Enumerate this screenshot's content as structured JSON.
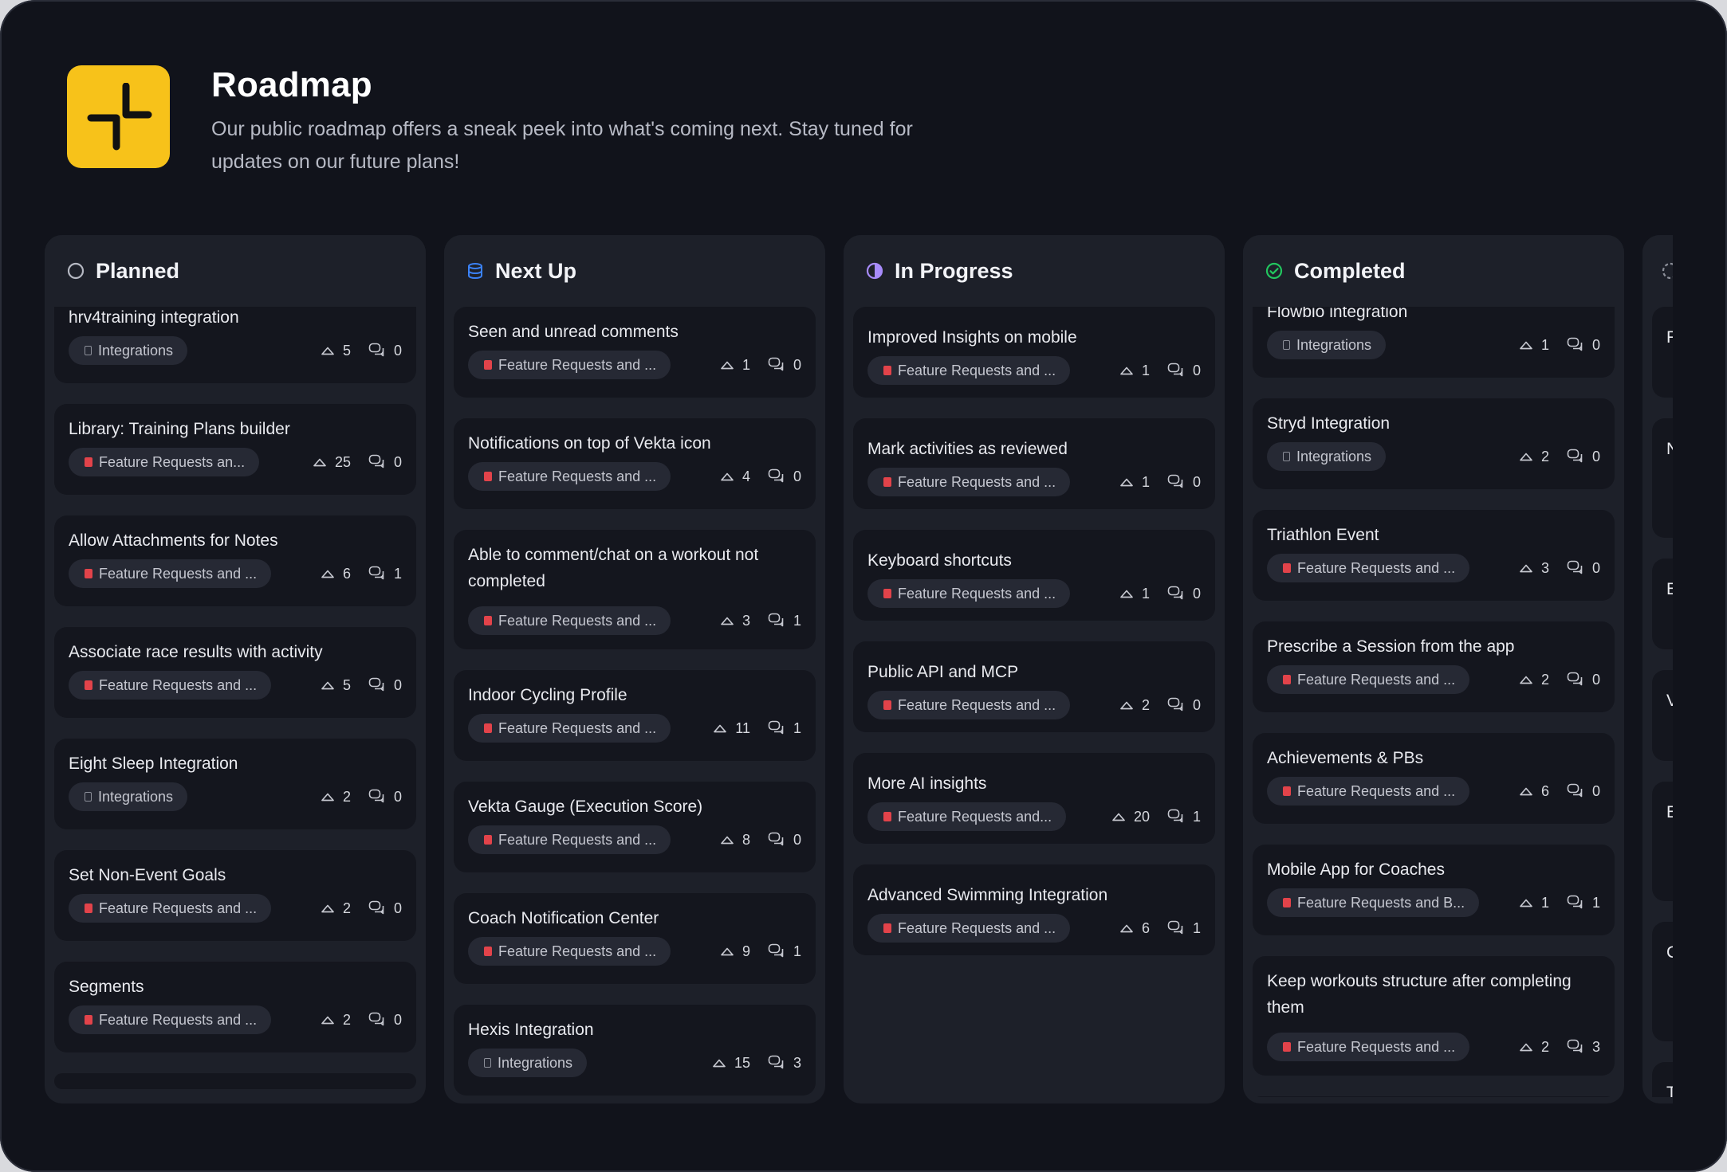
{
  "header": {
    "title": "Roadmap",
    "subtitle": "Our public roadmap offers a sneak peek into what's coming next. Stay tuned for updates on our future plans!"
  },
  "colors": {
    "logo": "#f7c21a",
    "background": "#11131b",
    "column": "#1d2029",
    "card": "#14161e",
    "tag_red": "#e2434a"
  },
  "columns": [
    {
      "title": "Planned",
      "icon": "circle-outline-icon",
      "cards": [
        {
          "title": "hrv4training integration",
          "tag": "Integrations",
          "tag_icon": "folder-icon",
          "votes": "5",
          "comments": "0"
        },
        {
          "title": "Library: Training Plans builder",
          "tag": "Feature Requests an...",
          "tag_icon": "red-flag-icon",
          "votes": "25",
          "comments": "0"
        },
        {
          "title": "Allow Attachments for Notes",
          "tag": "Feature Requests and ...",
          "tag_icon": "red-flag-icon",
          "votes": "6",
          "comments": "1"
        },
        {
          "title": "Associate race results with activity",
          "tag": "Feature Requests and ...",
          "tag_icon": "red-flag-icon",
          "votes": "5",
          "comments": "0"
        },
        {
          "title": "Eight Sleep Integration",
          "tag": "Integrations",
          "tag_icon": "folder-icon",
          "votes": "2",
          "comments": "0"
        },
        {
          "title": "Set Non-Event Goals",
          "tag": "Feature Requests and ...",
          "tag_icon": "red-flag-icon",
          "votes": "2",
          "comments": "0"
        },
        {
          "title": "Segments",
          "tag": "Feature Requests and ...",
          "tag_icon": "red-flag-icon",
          "votes": "2",
          "comments": "0"
        }
      ]
    },
    {
      "title": "Next Up",
      "icon": "stack-icon",
      "cards": [
        {
          "title": "Seen and unread comments",
          "tag": "Feature Requests and ...",
          "tag_icon": "red-flag-icon",
          "votes": "1",
          "comments": "0"
        },
        {
          "title": "Notifications on top of Vekta icon",
          "tag": "Feature Requests and ...",
          "tag_icon": "red-flag-icon",
          "votes": "4",
          "comments": "0"
        },
        {
          "title": "Able to comment/chat on a workout not completed",
          "tag": "Feature Requests and ...",
          "tag_icon": "red-flag-icon",
          "votes": "3",
          "comments": "1"
        },
        {
          "title": "Indoor Cycling Profile",
          "tag": "Feature Requests and ...",
          "tag_icon": "red-flag-icon",
          "votes": "11",
          "comments": "1"
        },
        {
          "title": "Vekta Gauge (Execution Score)",
          "tag": "Feature Requests and ...",
          "tag_icon": "red-flag-icon",
          "votes": "8",
          "comments": "0"
        },
        {
          "title": "Coach Notification Center",
          "tag": "Feature Requests and ...",
          "tag_icon": "red-flag-icon",
          "votes": "9",
          "comments": "1"
        },
        {
          "title": "Hexis Integration",
          "tag": "Integrations",
          "tag_icon": "folder-icon",
          "votes": "15",
          "comments": "3"
        }
      ]
    },
    {
      "title": "In Progress",
      "icon": "half-circle-icon",
      "cards": [
        {
          "title": "Improved Insights on mobile",
          "tag": "Feature Requests and ...",
          "tag_icon": "red-flag-icon",
          "votes": "1",
          "comments": "0"
        },
        {
          "title": "Mark activities as reviewed",
          "tag": "Feature Requests and ...",
          "tag_icon": "red-flag-icon",
          "votes": "1",
          "comments": "0"
        },
        {
          "title": "Keyboard shortcuts",
          "tag": "Feature Requests and ...",
          "tag_icon": "red-flag-icon",
          "votes": "1",
          "comments": "0"
        },
        {
          "title": "Public API and MCP",
          "tag": "Feature Requests and ...",
          "tag_icon": "red-flag-icon",
          "votes": "2",
          "comments": "0"
        },
        {
          "title": "More AI insights",
          "tag": "Feature Requests and...",
          "tag_icon": "red-flag-icon",
          "votes": "20",
          "comments": "1"
        },
        {
          "title": "Advanced Swimming Integration",
          "tag": "Feature Requests and ...",
          "tag_icon": "red-flag-icon",
          "votes": "6",
          "comments": "1"
        }
      ]
    },
    {
      "title": "Completed",
      "icon": "check-circle-icon",
      "cards": [
        {
          "title": "Flowbio integration",
          "tag": "Integrations",
          "tag_icon": "folder-icon",
          "votes": "1",
          "comments": "0"
        },
        {
          "title": "Stryd Integration",
          "tag": "Integrations",
          "tag_icon": "folder-icon",
          "votes": "2",
          "comments": "0"
        },
        {
          "title": "Triathlon Event",
          "tag": "Feature Requests and ...",
          "tag_icon": "red-flag-icon",
          "votes": "3",
          "comments": "0"
        },
        {
          "title": "Prescribe a Session from the app",
          "tag": "Feature Requests and ...",
          "tag_icon": "red-flag-icon",
          "votes": "2",
          "comments": "0"
        },
        {
          "title": "Achievements & PBs",
          "tag": "Feature Requests and ...",
          "tag_icon": "red-flag-icon",
          "votes": "6",
          "comments": "0"
        },
        {
          "title": "Mobile App for Coaches",
          "tag": "Feature Requests and B...",
          "tag_icon": "red-flag-icon",
          "votes": "1",
          "comments": "1"
        },
        {
          "title": "Keep workouts structure after completing them",
          "tag": "Feature Requests and ...",
          "tag_icon": "red-flag-icon",
          "votes": "2",
          "comments": "3"
        }
      ]
    }
  ],
  "partial_column": {
    "icon": "status-icon",
    "card_initials": [
      "F",
      "N",
      "E",
      "V",
      "E",
      "C",
      "T"
    ]
  }
}
